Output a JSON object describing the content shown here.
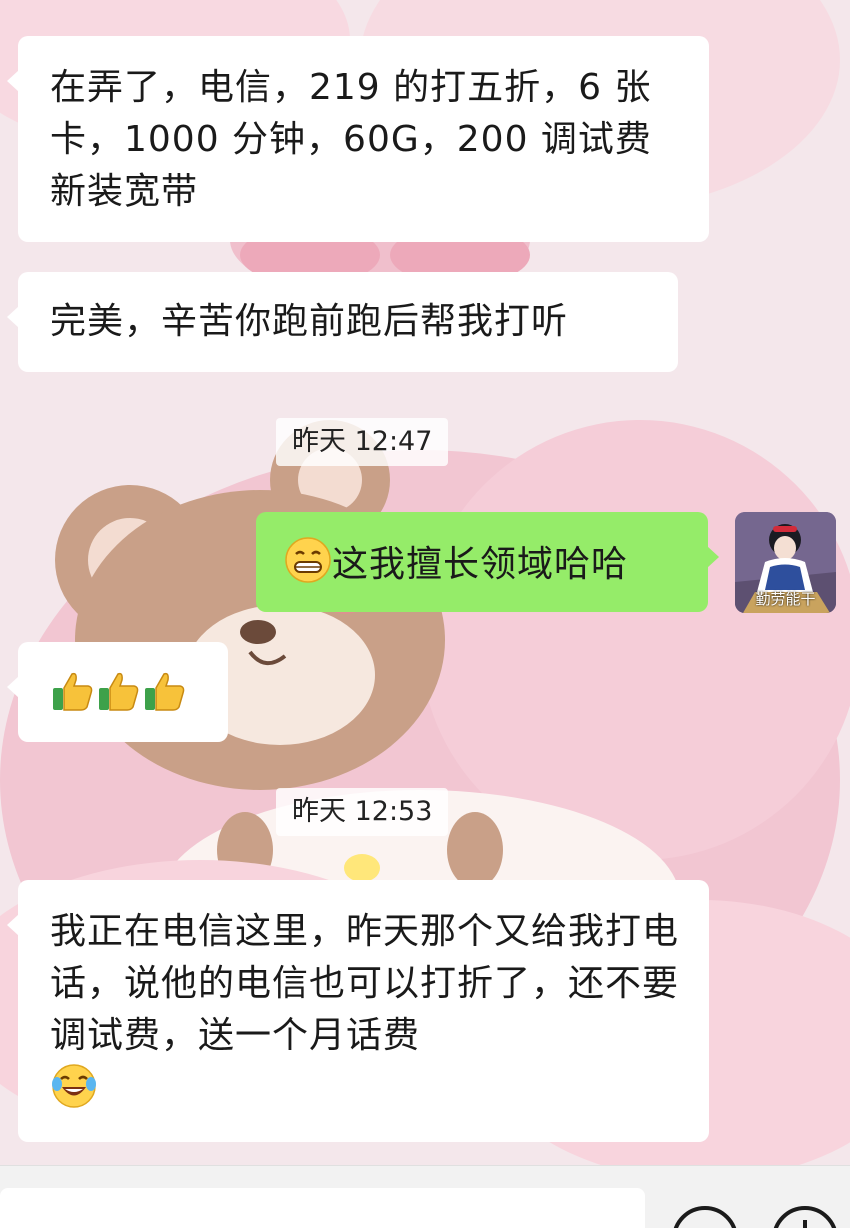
{
  "messages": [
    {
      "id": "m1",
      "direction": "in",
      "text": "在弄了，电信，219 的打五折，6 张卡，1000 分钟，60G，200 调试费新装宽带"
    },
    {
      "id": "m2",
      "direction": "in",
      "text": "完美，辛苦你跑前跑后帮我打听"
    },
    {
      "id": "t1",
      "type": "time",
      "text": "昨天 12:47"
    },
    {
      "id": "m3",
      "direction": "out",
      "emoji": "grin-icon",
      "text": "这我擅长领域哈哈"
    },
    {
      "id": "m4",
      "direction": "in",
      "emoji": [
        "thumbs-up-icon",
        "thumbs-up-icon",
        "thumbs-up-icon"
      ]
    },
    {
      "id": "t2",
      "type": "time",
      "text": "昨天 12:53"
    },
    {
      "id": "m5",
      "direction": "in",
      "text": "我正在电信这里，昨天那个又给我打电话，说他的电信也可以打折了，还不要调试费，送一个月话费",
      "emoji": "laughing-tears-icon"
    }
  ],
  "avatar": {
    "caption": "勤劳能干"
  },
  "colors": {
    "incoming": "#ffffff",
    "outgoing": "#95ec69",
    "background": "#f3e6ea"
  }
}
